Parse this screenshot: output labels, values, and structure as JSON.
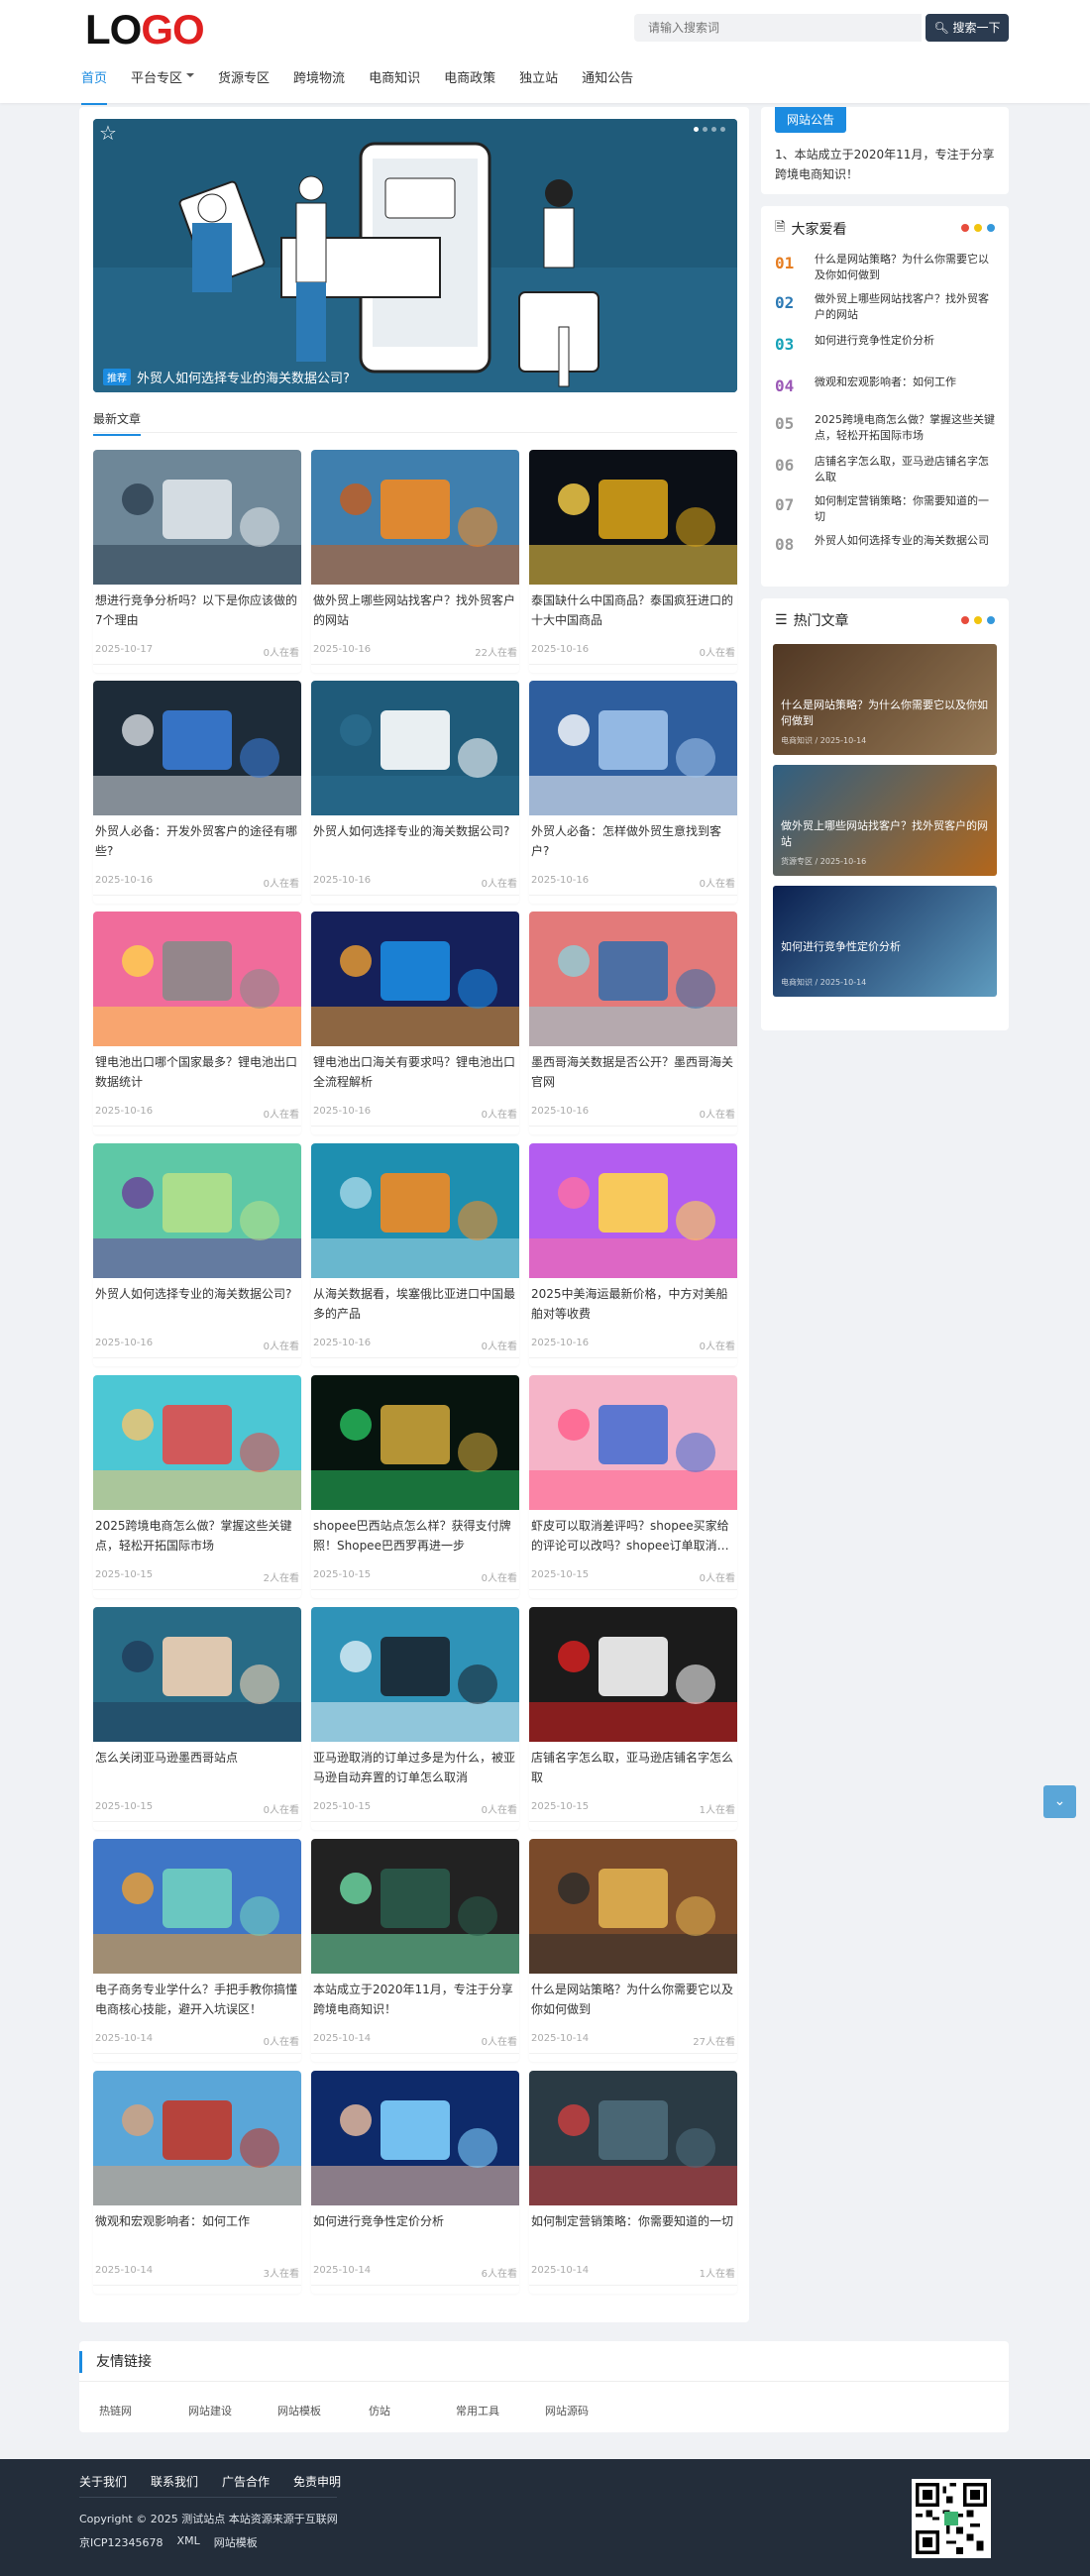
{
  "header": {
    "logo_a": "LO",
    "logo_b": "GO",
    "search_placeholder": "请输入搜索词",
    "search_button": "搜索一下",
    "nav": [
      "首页",
      "平台专区",
      "货源专区",
      "跨境物流",
      "电商知识",
      "电商政策",
      "独立站",
      "通知公告"
    ]
  },
  "slider": {
    "tag": "推荐",
    "caption": "外贸人如何选择专业的海关数据公司?"
  },
  "section_title": "最新文章",
  "articles": [
    {
      "title": "想进行竞争分析吗？以下是你应该做的7个理由",
      "date": "2025-10-17",
      "views": "0人在看"
    },
    {
      "title": "做外贸上哪些网站找客户？找外贸客户的网站",
      "date": "2025-10-16",
      "views": "22人在看"
    },
    {
      "title": "泰国缺什么中国商品？泰国疯狂进口的十大中国商品",
      "date": "2025-10-16",
      "views": "0人在看"
    },
    {
      "title": "外贸人必备：开发外贸客户的途径有哪些?",
      "date": "2025-10-16",
      "views": "0人在看"
    },
    {
      "title": "外贸人如何选择专业的海关数据公司?",
      "date": "2025-10-16",
      "views": "0人在看"
    },
    {
      "title": "外贸人必备：怎样做外贸生意找到客户?",
      "date": "2025-10-16",
      "views": "0人在看"
    },
    {
      "title": "锂电池出口哪个国家最多？锂电池出口数据统计",
      "date": "2025-10-16",
      "views": "0人在看"
    },
    {
      "title": "锂电池出口海关有要求吗？锂电池出口全流程解析",
      "date": "2025-10-16",
      "views": "0人在看"
    },
    {
      "title": "墨西哥海关数据是否公开？墨西哥海关官网",
      "date": "2025-10-16",
      "views": "0人在看"
    },
    {
      "title": "外贸人如何选择专业的海关数据公司?",
      "date": "2025-10-16",
      "views": "0人在看"
    },
    {
      "title": "从海关数据看，埃塞俄比亚进口中国最多的产品",
      "date": "2025-10-16",
      "views": "0人在看"
    },
    {
      "title": "2025中美海运最新价格，中方对美船舶对等收费",
      "date": "2025-10-16",
      "views": "0人在看"
    },
    {
      "title": "2025跨境电商怎么做？掌握这些关键点，轻松开拓国际市场",
      "date": "2025-10-15",
      "views": "2人在看"
    },
    {
      "title": "shopee巴西站点怎么样？获得支付牌照！Shopee巴西罗再进一步",
      "date": "2025-10-15",
      "views": "0人在看"
    },
    {
      "title": "虾皮可以取消差评吗？shopee买家给的评论可以改吗？shopee订单取消…",
      "date": "2025-10-15",
      "views": "0人在看"
    },
    {
      "title": "怎么关闭亚马逊墨西哥站点",
      "date": "2025-10-15",
      "views": "0人在看"
    },
    {
      "title": "亚马逊取消的订单过多是为什么，被亚马逊自动弃置的订单怎么取消",
      "date": "2025-10-15",
      "views": "0人在看"
    },
    {
      "title": "店铺名字怎么取，亚马逊店铺名字怎么取",
      "date": "2025-10-15",
      "views": "1人在看"
    },
    {
      "title": "电子商务专业学什么？手把手教你搞懂电商核心技能，避开入坑误区！",
      "date": "2025-10-14",
      "views": "0人在看"
    },
    {
      "title": "本站成立于2020年11月，专注于分享跨境电商知识！",
      "date": "2025-10-14",
      "views": "0人在看"
    },
    {
      "title": "什么是网站策略？为什么你需要它以及你如何做到",
      "date": "2025-10-14",
      "views": "27人在看"
    },
    {
      "title": "微观和宏观影响者：如何工作",
      "date": "2025-10-14",
      "views": "3人在看"
    },
    {
      "title": "如何进行竞争性定价分析",
      "date": "2025-10-14",
      "views": "6人在看"
    },
    {
      "title": "如何制定营销策略：你需要知道的一切",
      "date": "2025-10-14",
      "views": "1人在看"
    }
  ],
  "notice": {
    "tab": "网站公告",
    "text": "1、本站成立于2020年11月，专注于分享跨境电商知识！"
  },
  "popular": {
    "title": "大家爱看",
    "items": [
      {
        "num": "01",
        "title": "什么是网站策略？为什么你需要它以及你如何做到"
      },
      {
        "num": "02",
        "title": "做外贸上哪些网站找客户？找外贸客户的网站"
      },
      {
        "num": "03",
        "title": "如何进行竞争性定价分析"
      },
      {
        "num": "04",
        "title": "微观和宏观影响者：如何工作"
      },
      {
        "num": "05",
        "title": "2025跨境电商怎么做？掌握这些关键点，轻松开拓国际市场"
      },
      {
        "num": "06",
        "title": "店铺名字怎么取，亚马逊店铺名字怎么取"
      },
      {
        "num": "07",
        "title": "如何制定营销策略：你需要知道的一切"
      },
      {
        "num": "08",
        "title": "外贸人如何选择专业的海关数据公司"
      }
    ]
  },
  "hot": {
    "title": "热门文章",
    "items": [
      {
        "title": "什么是网站策略？为什么你需要它以及你如何做到",
        "meta": "电商知识 / 2025-10-14"
      },
      {
        "title": "做外贸上哪些网站找客户？找外贸客户的网站",
        "meta": "货源专区 / 2025-10-16"
      },
      {
        "title": "如何进行竞争性定价分析",
        "meta": "电商知识 / 2025-10-14"
      }
    ]
  },
  "links": {
    "title": "友情链接",
    "items": [
      "热链网",
      "网站建设",
      "网站模板",
      "仿站",
      "常用工具",
      "网站源码"
    ]
  },
  "footer": {
    "nav": [
      "关于我们",
      "联系我们",
      "广告合作",
      "免责申明"
    ],
    "copyright": "Copyright © 2025 测试站点 本站资源来源于互联网",
    "icp": "京ICP12345678",
    "xml": "XML",
    "map": "网站模板"
  },
  "colors": {
    "accent": "#1b8be0",
    "footer_bg": "#232d3a",
    "rank_colors": [
      "#e67e22",
      "#2c7ab5",
      "#17a2b8",
      "#9b59b6",
      "#999999",
      "#999999",
      "#999999",
      "#999999"
    ],
    "dots": [
      "#e74c3c",
      "#f1c40f",
      "#3498db"
    ]
  }
}
